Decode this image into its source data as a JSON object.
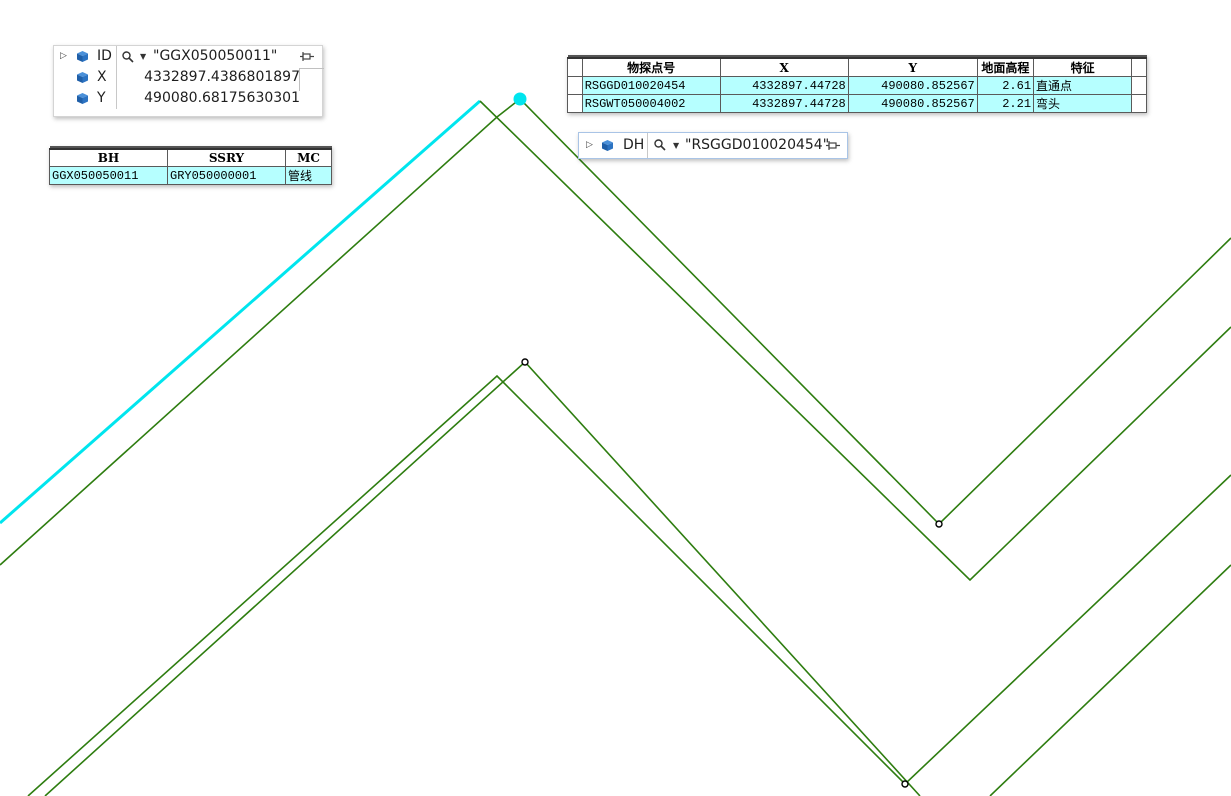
{
  "identify_tips": [
    {
      "field": "ID",
      "query_value": "\"GGX050050011\"",
      "children": [
        {
          "field": "X",
          "value": "4332897.4386801897"
        },
        {
          "field": "Y",
          "value": "490080.68175630301"
        }
      ]
    },
    {
      "field": "DH",
      "query_value": "\"RSGGD010020454\""
    }
  ],
  "line_table": {
    "columns": [
      "BH",
      "SSRY",
      "MC"
    ],
    "rows": [
      [
        "GGX050050011",
        "GRY050000001",
        "管线"
      ]
    ]
  },
  "point_table": {
    "columns": [
      "物探点号",
      "X",
      "Y",
      "地面高程",
      "特征"
    ],
    "rows": [
      [
        "RSGGD010020454",
        "4332897.44728",
        "490080.852567",
        "2.61",
        "直通点"
      ],
      [
        "RSGWT050004002",
        "4332897.44728",
        "490080.852567",
        "2.21",
        "弯头"
      ]
    ]
  },
  "map": {
    "pipe_color": "#2e7d10",
    "selected_color": "#00e5ee",
    "vertex_color": "#000000",
    "icons": [
      "expand-triangle-icon",
      "layer-cube-icon",
      "search-icon",
      "dropdown-arrow-icon",
      "pin-icon"
    ]
  }
}
